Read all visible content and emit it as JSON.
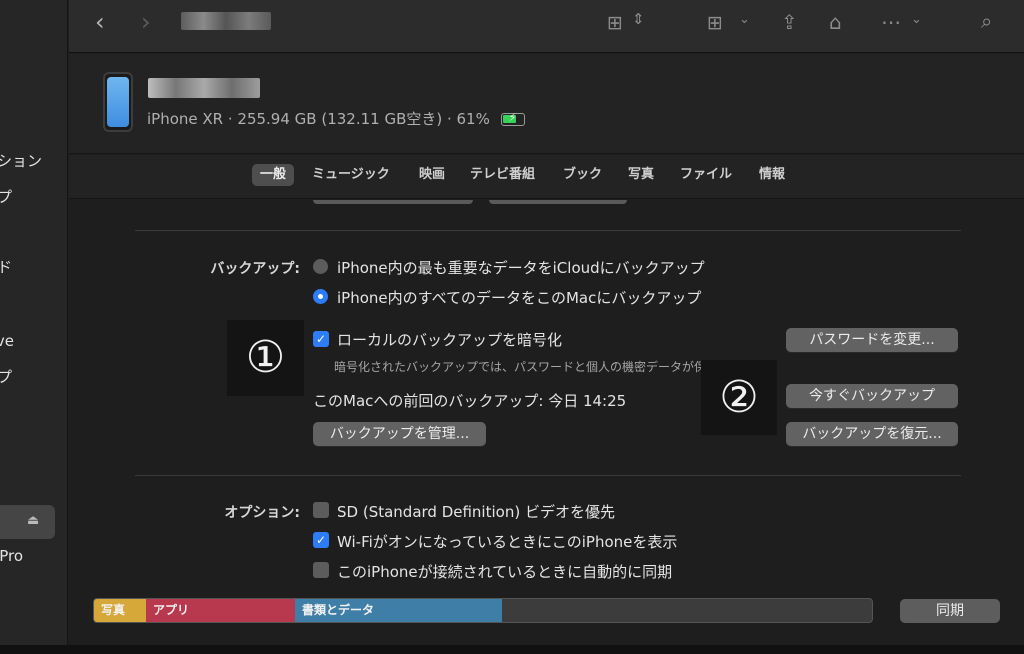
{
  "sidebar": {
    "fragments": [
      "ション",
      "プ",
      "ド",
      "ve",
      "プ",
      "Pro"
    ],
    "eject_icon": "eject-icon"
  },
  "toolbar": {
    "icons": [
      "back-icon",
      "forward-icon",
      "grid-view-icon",
      "group-icon",
      "share-icon",
      "tag-icon",
      "more-icon",
      "search-icon"
    ]
  },
  "device": {
    "info": "iPhone XR · 255.94 GB (132.11 GB空き) · 61%"
  },
  "tabs": [
    "一般",
    "ミュージック",
    "映画",
    "テレビ番組",
    "ブック",
    "写真",
    "ファイル",
    "情報"
  ],
  "backup": {
    "label": "バックアップ:",
    "option_icloud": "iPhone内の最も重要なデータをiCloudにバックアップ",
    "option_mac": "iPhone内のすべてのデータをこのMacにバックアップ",
    "encrypt_label": "ローカルのバックアップを暗号化",
    "encrypt_note": "暗号化されたバックアップでは、パスワードと個人の機密データが保護されます。",
    "last_backup": "このMacへの前回のバックアップ: 今日 14:25",
    "manage_button": "バックアップを管理...",
    "change_password_button": "パスワードを変更...",
    "backup_now_button": "今すぐバックアップ",
    "restore_button": "バックアップを復元..."
  },
  "options": {
    "label": "オプション:",
    "sd_video": "SD (Standard Definition) ビデオを優先",
    "wifi_show": "Wi-FiがオンになっているときにこのiPhoneを表示",
    "auto_sync": "このiPhoneが接続されているときに自動的に同期"
  },
  "annotations": {
    "marker1": "①",
    "marker2": "②"
  },
  "storage": {
    "segments": [
      {
        "label": "写真",
        "color": "#d6a83a"
      },
      {
        "label": "アプリ",
        "color": "#b8394d"
      },
      {
        "label": "書類とデータ",
        "color": "#3f7ea6"
      }
    ]
  },
  "sync_button": "同期",
  "colors": {
    "accent": "#2f7df6",
    "battery": "#37d158"
  }
}
